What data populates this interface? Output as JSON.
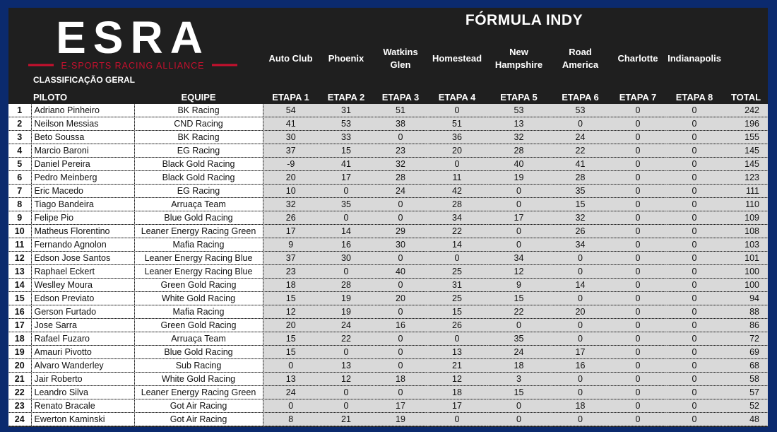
{
  "title": "FÓRMULA INDY",
  "logo": {
    "main": "ESRA",
    "sub": "E-SPORTS RACING ALLIANCE"
  },
  "classification_label": "CLASSIFICAÇÃO GERAL",
  "headers": {
    "pilot": "PILOTO",
    "team": "EQUIPE",
    "total": "TOTAL"
  },
  "stages": [
    {
      "track": "Auto Club",
      "label": "ETAPA 1"
    },
    {
      "track": "Phoenix",
      "label": "ETAPA 2"
    },
    {
      "track": "Watkins\nGlen",
      "label": "ETAPA 3"
    },
    {
      "track": "Homestead",
      "label": "ETAPA 4"
    },
    {
      "track": "New\nHampshire",
      "label": "ETAPA 5"
    },
    {
      "track": "Road\nAmerica",
      "label": "ETAPA 6"
    },
    {
      "track": "Charlotte",
      "label": "ETAPA 7"
    },
    {
      "track": "Indianapolis",
      "label": "ETAPA 8"
    }
  ],
  "rows": [
    {
      "pos": "1",
      "pilot": "Adriano Pinheiro",
      "team": "BK Racing",
      "points": [
        "54",
        "31",
        "51",
        "0",
        "53",
        "53",
        "0",
        "0"
      ],
      "total": "242"
    },
    {
      "pos": "2",
      "pilot": "Neilson Messias",
      "team": "CND Racing",
      "points": [
        "41",
        "53",
        "38",
        "51",
        "13",
        "0",
        "0",
        "0"
      ],
      "total": "196"
    },
    {
      "pos": "3",
      "pilot": "Beto Soussa",
      "team": "BK Racing",
      "points": [
        "30",
        "33",
        "0",
        "36",
        "32",
        "24",
        "0",
        "0"
      ],
      "total": "155"
    },
    {
      "pos": "4",
      "pilot": "Marcio Baroni",
      "team": "EG Racing",
      "points": [
        "37",
        "15",
        "23",
        "20",
        "28",
        "22",
        "0",
        "0"
      ],
      "total": "145"
    },
    {
      "pos": "5",
      "pilot": "Daniel Pereira",
      "team": "Black Gold Racing",
      "points": [
        "-9",
        "41",
        "32",
        "0",
        "40",
        "41",
        "0",
        "0"
      ],
      "total": "145"
    },
    {
      "pos": "6",
      "pilot": "Pedro Meinberg",
      "team": "Black Gold Racing",
      "points": [
        "20",
        "17",
        "28",
        "11",
        "19",
        "28",
        "0",
        "0"
      ],
      "total": "123"
    },
    {
      "pos": "7",
      "pilot": "Eric Macedo",
      "team": "EG Racing",
      "points": [
        "10",
        "0",
        "24",
        "42",
        "0",
        "35",
        "0",
        "0"
      ],
      "total": "111"
    },
    {
      "pos": "8",
      "pilot": "Tiago Bandeira",
      "team": "Arruaça Team",
      "points": [
        "32",
        "35",
        "0",
        "28",
        "0",
        "15",
        "0",
        "0"
      ],
      "total": "110"
    },
    {
      "pos": "9",
      "pilot": "Felipe Pio",
      "team": "Blue Gold Racing",
      "points": [
        "26",
        "0",
        "0",
        "34",
        "17",
        "32",
        "0",
        "0"
      ],
      "total": "109"
    },
    {
      "pos": "10",
      "pilot": "Matheus Florentino",
      "team": "Leaner Energy Racing Green",
      "points": [
        "17",
        "14",
        "29",
        "22",
        "0",
        "26",
        "0",
        "0"
      ],
      "total": "108"
    },
    {
      "pos": "11",
      "pilot": "Fernando Agnolon",
      "team": "Mafia Racing",
      "points": [
        "9",
        "16",
        "30",
        "14",
        "0",
        "34",
        "0",
        "0"
      ],
      "total": "103"
    },
    {
      "pos": "12",
      "pilot": "Edson Jose Santos",
      "team": "Leaner Energy Racing Blue",
      "points": [
        "37",
        "30",
        "0",
        "0",
        "34",
        "0",
        "0",
        "0"
      ],
      "total": "101"
    },
    {
      "pos": "13",
      "pilot": "Raphael Eckert",
      "team": "Leaner Energy Racing Blue",
      "points": [
        "23",
        "0",
        "40",
        "25",
        "12",
        "0",
        "0",
        "0"
      ],
      "total": "100"
    },
    {
      "pos": "14",
      "pilot": "Weslley Moura",
      "team": "Green Gold Racing",
      "points": [
        "18",
        "28",
        "0",
        "31",
        "9",
        "14",
        "0",
        "0"
      ],
      "total": "100"
    },
    {
      "pos": "15",
      "pilot": "Edson Previato",
      "team": "White Gold Racing",
      "points": [
        "15",
        "19",
        "20",
        "25",
        "15",
        "0",
        "0",
        "0"
      ],
      "total": "94"
    },
    {
      "pos": "16",
      "pilot": "Gerson Furtado",
      "team": "Mafia Racing",
      "points": [
        "12",
        "19",
        "0",
        "15",
        "22",
        "20",
        "0",
        "0"
      ],
      "total": "88"
    },
    {
      "pos": "17",
      "pilot": "Jose Sarra",
      "team": "Green Gold Racing",
      "points": [
        "20",
        "24",
        "16",
        "26",
        "0",
        "0",
        "0",
        "0"
      ],
      "total": "86"
    },
    {
      "pos": "18",
      "pilot": "Rafael Fuzaro",
      "team": "Arruaça Team",
      "points": [
        "15",
        "22",
        "0",
        "0",
        "35",
        "0",
        "0",
        "0"
      ],
      "total": "72"
    },
    {
      "pos": "19",
      "pilot": "Amauri Pivotto",
      "team": "Blue Gold Racing",
      "points": [
        "15",
        "0",
        "0",
        "13",
        "24",
        "17",
        "0",
        "0"
      ],
      "total": "69"
    },
    {
      "pos": "20",
      "pilot": "Alvaro Wanderley",
      "team": "Sub Racing",
      "points": [
        "0",
        "13",
        "0",
        "21",
        "18",
        "16",
        "0",
        "0"
      ],
      "total": "68"
    },
    {
      "pos": "21",
      "pilot": "Jair Roberto",
      "team": "White Gold Racing",
      "points": [
        "13",
        "12",
        "18",
        "12",
        "3",
        "0",
        "0",
        "0"
      ],
      "total": "58"
    },
    {
      "pos": "22",
      "pilot": "Leandro Silva",
      "team": "Leaner Energy Racing Green",
      "points": [
        "24",
        "0",
        "0",
        "18",
        "15",
        "0",
        "0",
        "0"
      ],
      "total": "57"
    },
    {
      "pos": "23",
      "pilot": "Renato Bracale",
      "team": "Got Air Racing",
      "points": [
        "0",
        "0",
        "17",
        "17",
        "0",
        "18",
        "0",
        "0"
      ],
      "total": "52"
    },
    {
      "pos": "24",
      "pilot": "Ewerton Kaminski",
      "team": "Got Air Racing",
      "points": [
        "8",
        "21",
        "19",
        "0",
        "0",
        "0",
        "0",
        "0"
      ],
      "total": "48"
    }
  ]
}
